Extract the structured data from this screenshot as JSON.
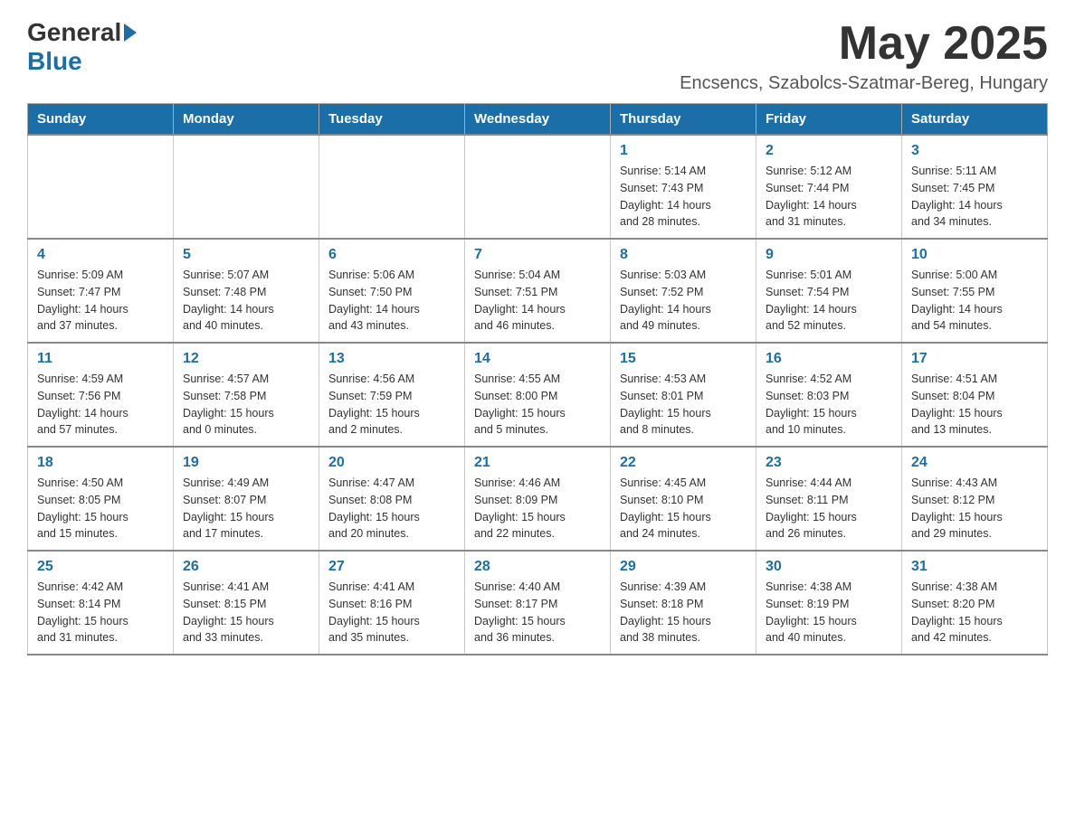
{
  "header": {
    "logo_general": "General",
    "logo_blue": "Blue",
    "month_title": "May 2025",
    "location": "Encsencs, Szabolcs-Szatmar-Bereg, Hungary"
  },
  "weekdays": [
    "Sunday",
    "Monday",
    "Tuesday",
    "Wednesday",
    "Thursday",
    "Friday",
    "Saturday"
  ],
  "weeks": [
    {
      "days": [
        {
          "num": "",
          "info": ""
        },
        {
          "num": "",
          "info": ""
        },
        {
          "num": "",
          "info": ""
        },
        {
          "num": "",
          "info": ""
        },
        {
          "num": "1",
          "info": "Sunrise: 5:14 AM\nSunset: 7:43 PM\nDaylight: 14 hours\nand 28 minutes."
        },
        {
          "num": "2",
          "info": "Sunrise: 5:12 AM\nSunset: 7:44 PM\nDaylight: 14 hours\nand 31 minutes."
        },
        {
          "num": "3",
          "info": "Sunrise: 5:11 AM\nSunset: 7:45 PM\nDaylight: 14 hours\nand 34 minutes."
        }
      ]
    },
    {
      "days": [
        {
          "num": "4",
          "info": "Sunrise: 5:09 AM\nSunset: 7:47 PM\nDaylight: 14 hours\nand 37 minutes."
        },
        {
          "num": "5",
          "info": "Sunrise: 5:07 AM\nSunset: 7:48 PM\nDaylight: 14 hours\nand 40 minutes."
        },
        {
          "num": "6",
          "info": "Sunrise: 5:06 AM\nSunset: 7:50 PM\nDaylight: 14 hours\nand 43 minutes."
        },
        {
          "num": "7",
          "info": "Sunrise: 5:04 AM\nSunset: 7:51 PM\nDaylight: 14 hours\nand 46 minutes."
        },
        {
          "num": "8",
          "info": "Sunrise: 5:03 AM\nSunset: 7:52 PM\nDaylight: 14 hours\nand 49 minutes."
        },
        {
          "num": "9",
          "info": "Sunrise: 5:01 AM\nSunset: 7:54 PM\nDaylight: 14 hours\nand 52 minutes."
        },
        {
          "num": "10",
          "info": "Sunrise: 5:00 AM\nSunset: 7:55 PM\nDaylight: 14 hours\nand 54 minutes."
        }
      ]
    },
    {
      "days": [
        {
          "num": "11",
          "info": "Sunrise: 4:59 AM\nSunset: 7:56 PM\nDaylight: 14 hours\nand 57 minutes."
        },
        {
          "num": "12",
          "info": "Sunrise: 4:57 AM\nSunset: 7:58 PM\nDaylight: 15 hours\nand 0 minutes."
        },
        {
          "num": "13",
          "info": "Sunrise: 4:56 AM\nSunset: 7:59 PM\nDaylight: 15 hours\nand 2 minutes."
        },
        {
          "num": "14",
          "info": "Sunrise: 4:55 AM\nSunset: 8:00 PM\nDaylight: 15 hours\nand 5 minutes."
        },
        {
          "num": "15",
          "info": "Sunrise: 4:53 AM\nSunset: 8:01 PM\nDaylight: 15 hours\nand 8 minutes."
        },
        {
          "num": "16",
          "info": "Sunrise: 4:52 AM\nSunset: 8:03 PM\nDaylight: 15 hours\nand 10 minutes."
        },
        {
          "num": "17",
          "info": "Sunrise: 4:51 AM\nSunset: 8:04 PM\nDaylight: 15 hours\nand 13 minutes."
        }
      ]
    },
    {
      "days": [
        {
          "num": "18",
          "info": "Sunrise: 4:50 AM\nSunset: 8:05 PM\nDaylight: 15 hours\nand 15 minutes."
        },
        {
          "num": "19",
          "info": "Sunrise: 4:49 AM\nSunset: 8:07 PM\nDaylight: 15 hours\nand 17 minutes."
        },
        {
          "num": "20",
          "info": "Sunrise: 4:47 AM\nSunset: 8:08 PM\nDaylight: 15 hours\nand 20 minutes."
        },
        {
          "num": "21",
          "info": "Sunrise: 4:46 AM\nSunset: 8:09 PM\nDaylight: 15 hours\nand 22 minutes."
        },
        {
          "num": "22",
          "info": "Sunrise: 4:45 AM\nSunset: 8:10 PM\nDaylight: 15 hours\nand 24 minutes."
        },
        {
          "num": "23",
          "info": "Sunrise: 4:44 AM\nSunset: 8:11 PM\nDaylight: 15 hours\nand 26 minutes."
        },
        {
          "num": "24",
          "info": "Sunrise: 4:43 AM\nSunset: 8:12 PM\nDaylight: 15 hours\nand 29 minutes."
        }
      ]
    },
    {
      "days": [
        {
          "num": "25",
          "info": "Sunrise: 4:42 AM\nSunset: 8:14 PM\nDaylight: 15 hours\nand 31 minutes."
        },
        {
          "num": "26",
          "info": "Sunrise: 4:41 AM\nSunset: 8:15 PM\nDaylight: 15 hours\nand 33 minutes."
        },
        {
          "num": "27",
          "info": "Sunrise: 4:41 AM\nSunset: 8:16 PM\nDaylight: 15 hours\nand 35 minutes."
        },
        {
          "num": "28",
          "info": "Sunrise: 4:40 AM\nSunset: 8:17 PM\nDaylight: 15 hours\nand 36 minutes."
        },
        {
          "num": "29",
          "info": "Sunrise: 4:39 AM\nSunset: 8:18 PM\nDaylight: 15 hours\nand 38 minutes."
        },
        {
          "num": "30",
          "info": "Sunrise: 4:38 AM\nSunset: 8:19 PM\nDaylight: 15 hours\nand 40 minutes."
        },
        {
          "num": "31",
          "info": "Sunrise: 4:38 AM\nSunset: 8:20 PM\nDaylight: 15 hours\nand 42 minutes."
        }
      ]
    }
  ]
}
